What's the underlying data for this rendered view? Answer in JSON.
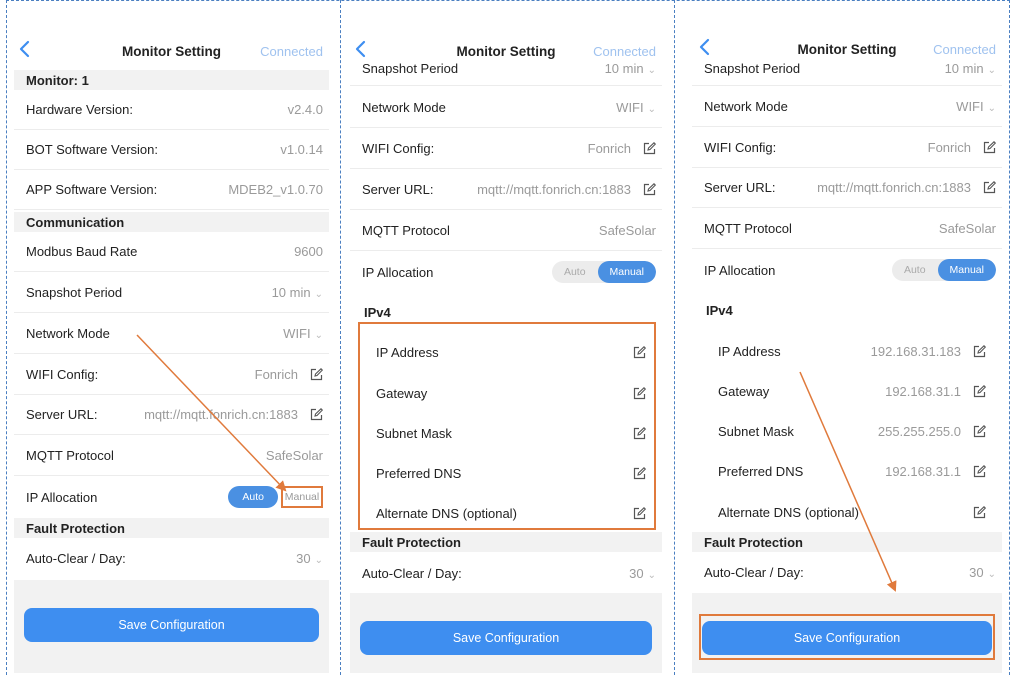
{
  "nav": {
    "title": "Monitor Setting",
    "status": "Connected"
  },
  "panel1": {
    "monitor_header": "Monitor: 1",
    "hardware_label": "Hardware Version:",
    "hardware_value": "v2.4.0",
    "bot_label": "BOT Software Version:",
    "bot_value": "v1.0.14",
    "app_label": "APP Software Version:",
    "app_value": "MDEB2_v1.0.70",
    "communication_header": "Communication",
    "baud_label": "Modbus Baud Rate",
    "baud_value": "9600",
    "snapshot_label": "Snapshot Period",
    "snapshot_value": "10 min",
    "network_label": "Network Mode",
    "network_value": "WIFI",
    "wifi_label": "WIFI Config:",
    "wifi_value": "Fonrich",
    "server_label": "Server URL:",
    "server_value": "mqtt://mqtt.fonrich.cn:1883",
    "mqtt_label": "MQTT Protocol",
    "mqtt_value": "SafeSolar",
    "ip_label": "IP Allocation",
    "ip_auto": "Auto",
    "ip_manual": "Manual",
    "fault_header": "Fault Protection",
    "autoclear_label": "Auto-Clear / Day:",
    "autoclear_value": "30",
    "save_label": "Save Configuration"
  },
  "panel2": {
    "snapshot_label": "Snapshot Period",
    "snapshot_value": "10 min",
    "network_label": "Network Mode",
    "network_value": "WIFI",
    "wifi_label": "WIFI Config:",
    "wifi_value": "Fonrich",
    "server_label": "Server URL:",
    "server_value": "mqtt://mqtt.fonrich.cn:1883",
    "mqtt_label": "MQTT Protocol",
    "mqtt_value": "SafeSolar",
    "ip_label": "IP Allocation",
    "ip_auto": "Auto",
    "ip_manual": "Manual",
    "ipv4_header": "IPv4",
    "ip_address_label": "IP Address",
    "gateway_label": "Gateway",
    "subnet_label": "Subnet Mask",
    "pdns_label": "Preferred DNS",
    "adns_label": "Alternate DNS (optional)",
    "fault_header": "Fault Protection",
    "autoclear_label": "Auto-Clear / Day:",
    "autoclear_value": "30",
    "save_label": "Save Configuration"
  },
  "panel3": {
    "snapshot_label": "Snapshot Period",
    "snapshot_value": "10 min",
    "network_label": "Network Mode",
    "network_value": "WIFI",
    "wifi_label": "WIFI Config:",
    "wifi_value": "Fonrich",
    "server_label": "Server URL:",
    "server_value": "mqtt://mqtt.fonrich.cn:1883",
    "mqtt_label": "MQTT Protocol",
    "mqtt_value": "SafeSolar",
    "ip_label": "IP Allocation",
    "ip_auto": "Auto",
    "ip_manual": "Manual",
    "ipv4_header": "IPv4",
    "ip_address_label": "IP Address",
    "ip_address_value": "192.168.31.183",
    "gateway_label": "Gateway",
    "gateway_value": "192.168.31.1",
    "subnet_label": "Subnet Mask",
    "subnet_value": "255.255.255.0",
    "pdns_label": "Preferred DNS",
    "pdns_value": "192.168.31.1",
    "adns_label": "Alternate DNS (optional)",
    "fault_header": "Fault Protection",
    "autoclear_label": "Auto-Clear / Day:",
    "autoclear_value": "30",
    "save_label": "Save Configuration"
  },
  "colors": {
    "accent": "#3e8ef0",
    "highlight": "#e07a3c",
    "status": "#9fc2ef"
  }
}
